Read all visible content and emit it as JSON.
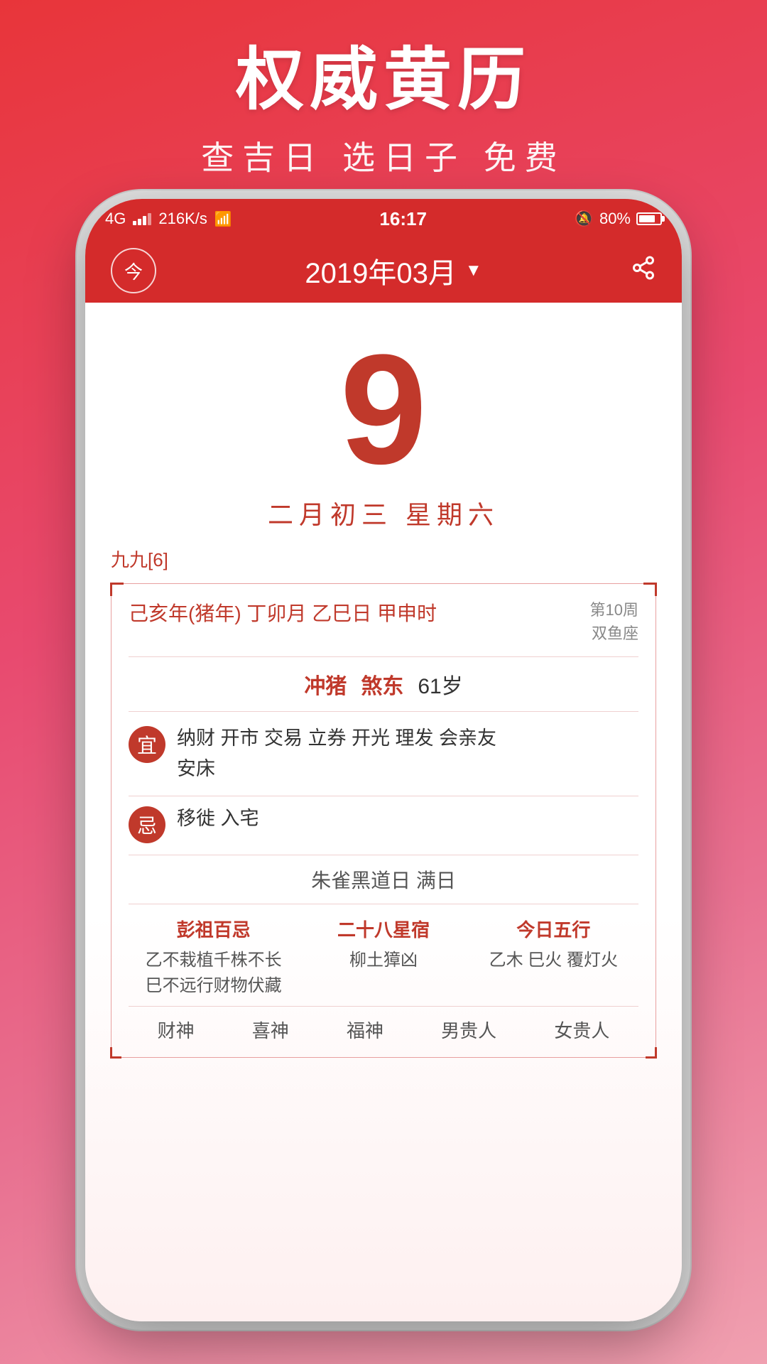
{
  "background": {
    "gradient_start": "#e8353a",
    "gradient_end": "#f0a0b0"
  },
  "top_section": {
    "main_title": "权威黄历",
    "sub_title": "查吉日 选日子 免费"
  },
  "status_bar": {
    "network": "4G",
    "speed": "216K/s",
    "wifi": "WiFi",
    "time": "16:17",
    "alarm": "🔕",
    "battery_percent": "80%"
  },
  "app_header": {
    "today_label": "今",
    "month_display": "2019年03月",
    "dropdown_arrow": "▼",
    "share_label": "share"
  },
  "date_display": {
    "day": "9",
    "lunar": "二月初三  星期六"
  },
  "almanac": {
    "nine_nine": "九九[6]",
    "ganzhi": "己亥年(猪年) 丁卯月  乙巳日  甲申时",
    "week_label": "第10周",
    "zodiac": "双鱼座",
    "chong": "冲猪",
    "sha": "煞东",
    "age": "61岁",
    "yi_label": "宜",
    "yi_content": "纳财 开市 交易 立券 开光 理发 会亲友\n安床",
    "ji_label": "忌",
    "ji_content": "移徙 入宅",
    "day_name": "朱雀黑道日  满日",
    "pengzu_title": "彭祖百忌",
    "pengzu_content": "乙不栽植千株不长\n巳不远行财物伏藏",
    "star_title": "二十八星宿",
    "star_content": "柳土獐凶",
    "wuxing_title": "今日五行",
    "wuxing_content": "乙木 巳火 覆灯火",
    "gods": [
      "财神",
      "喜神",
      "福神",
      "男贵人",
      "女贵人"
    ]
  }
}
